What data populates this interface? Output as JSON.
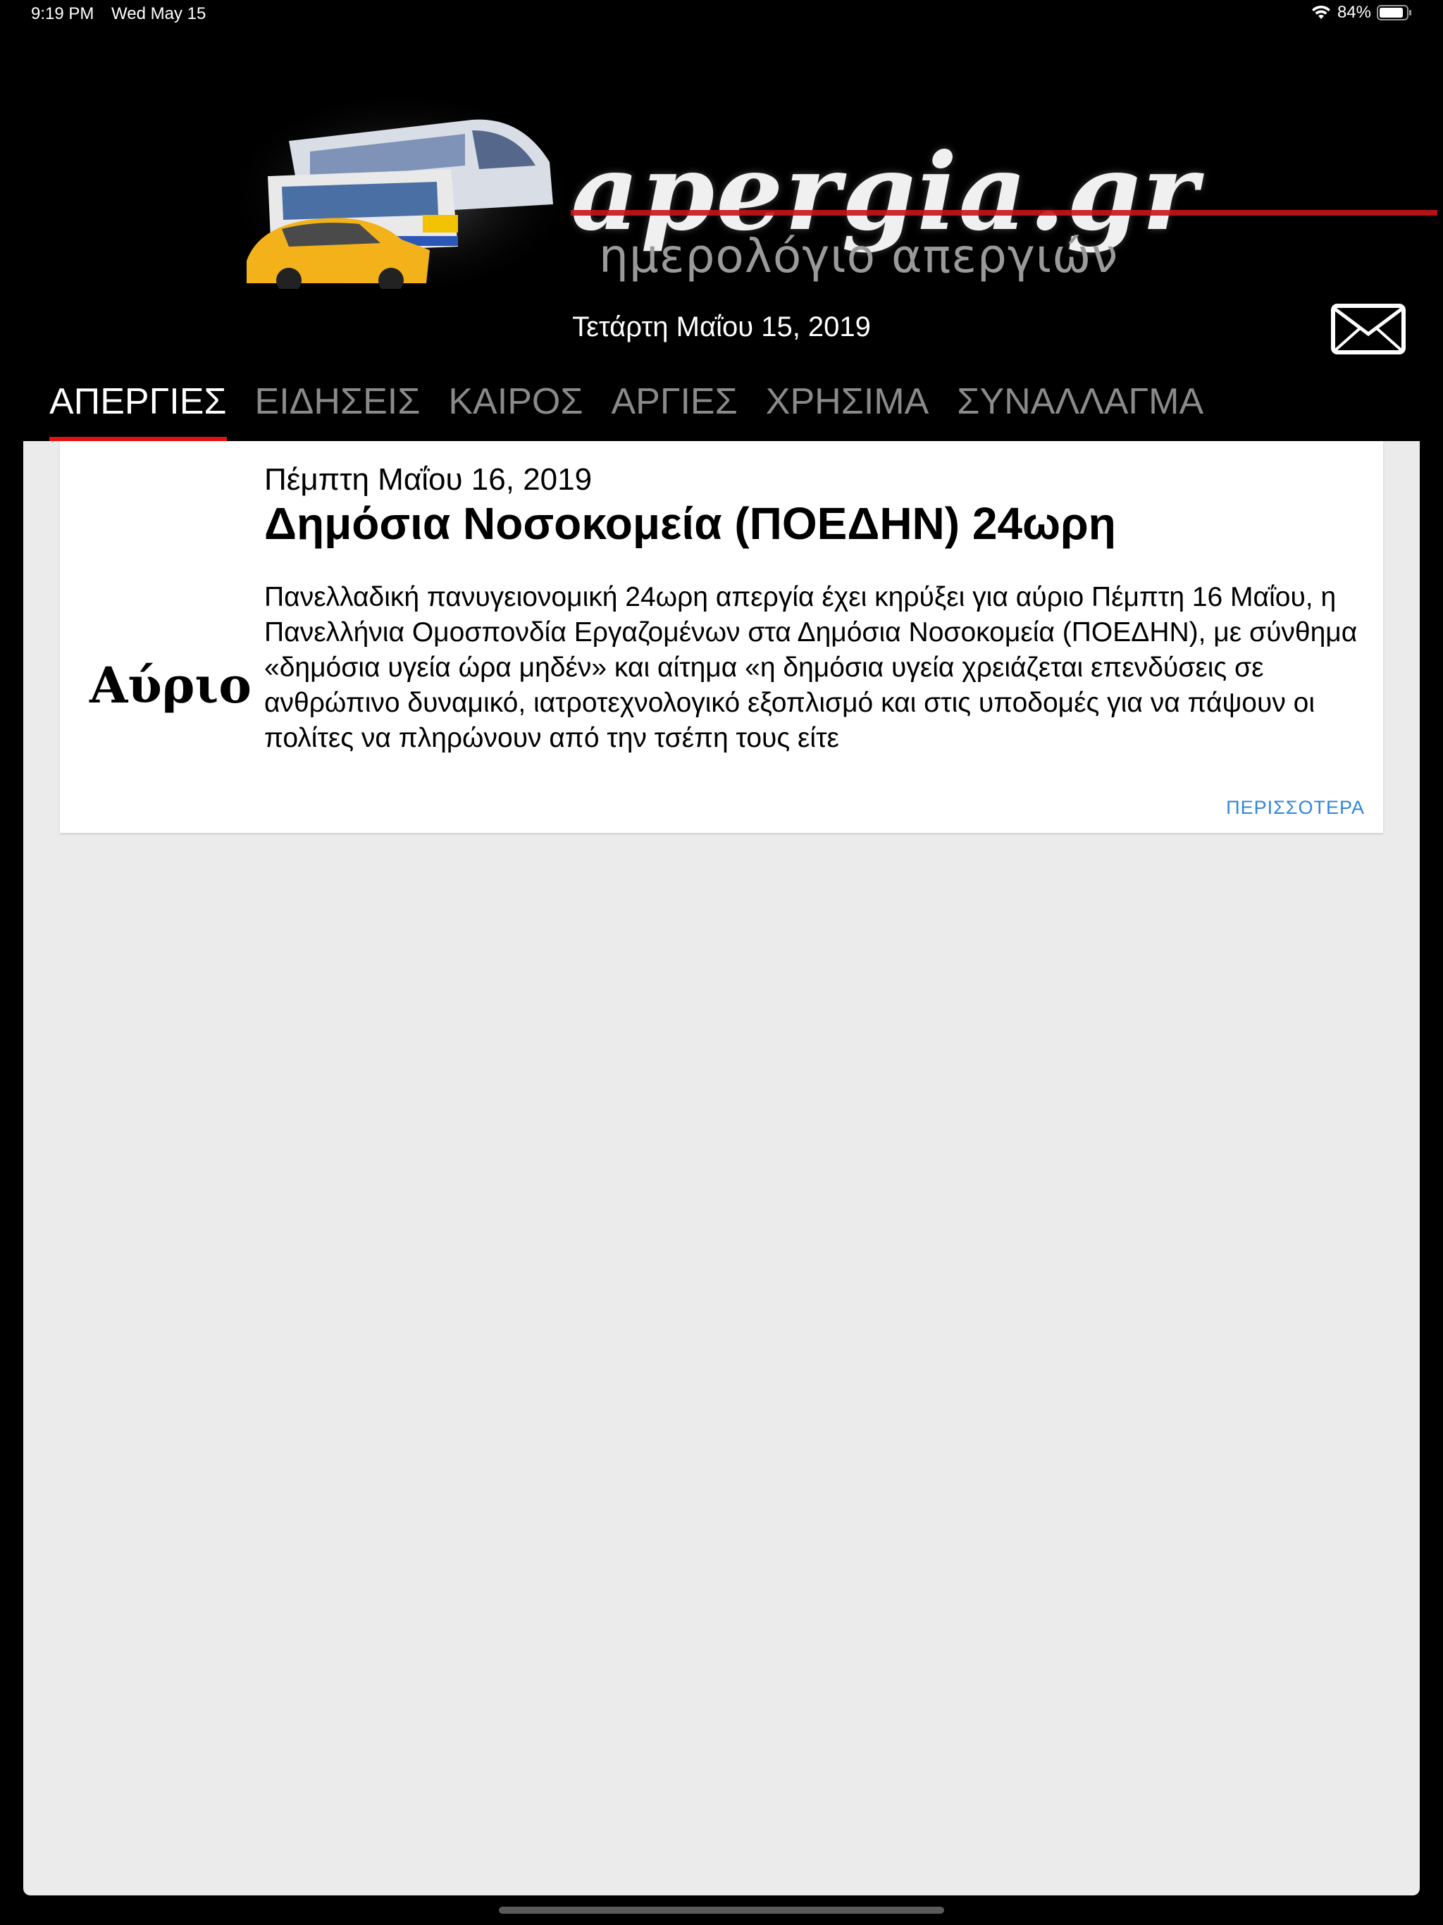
{
  "status_bar": {
    "time": "9:19 PM",
    "date": "Wed May 15",
    "battery": "84%",
    "wifi_icon": "wifi-icon",
    "battery_icon": "battery-icon"
  },
  "logo": {
    "wordmark": "apergia.gr",
    "tagline": "ημερολόγιο απεργιών"
  },
  "header": {
    "date": "Τετάρτη Μαΐου 15, 2019",
    "mail_icon": "mail-icon"
  },
  "tabs": [
    {
      "label": "ΑΠΕΡΓΙΕΣ",
      "active": true
    },
    {
      "label": "ΕΙΔΗΣΕΙΣ",
      "active": false
    },
    {
      "label": "ΚΑΙΡΟΣ",
      "active": false
    },
    {
      "label": "ΑΡΓΙΕΣ",
      "active": false
    },
    {
      "label": "ΧΡΗΣΙΜΑ",
      "active": false
    },
    {
      "label": "ΣΥΝΑΛΛΑΓΜΑ",
      "active": false
    }
  ],
  "cards": [
    {
      "badge": "Αύριο",
      "date": "Πέμπτη Μαΐου 16, 2019",
      "title": "Δημόσια Νοσοκομεία (ΠΟΕΔΗΝ) 24ωρη",
      "body": "Πανελλαδική πανυγειονομική 24ωρη απεργία έχει κηρύξει για αύριο Πέμπτη 16 Μαΐου, η Πανελλήνια Ομοσπονδία Εργαζομένων στα Δημόσια Νοσοκομεία (ΠΟΕΔΗΝ), με σύνθημα «δημόσια υγεία ώρα μηδέν» και αίτημα «η δημόσια υγεία χρειάζεται επενδύσεις σε ανθρώπινο δυναμικό, ιατροτεχνολογικό εξοπλισμό και στις υποδομές για να πάψουν οι πολίτες να πληρώνουν από την τσέπη τους είτε",
      "more_label": "ΠΕΡΙΣΣΟΤΕΡΑ"
    }
  ],
  "colors": {
    "background": "#000000",
    "content_bg": "#ebebeb",
    "active_tab_underline": "#e41010",
    "link": "#2e86de",
    "inactive_tab": "#8a8a8a"
  }
}
